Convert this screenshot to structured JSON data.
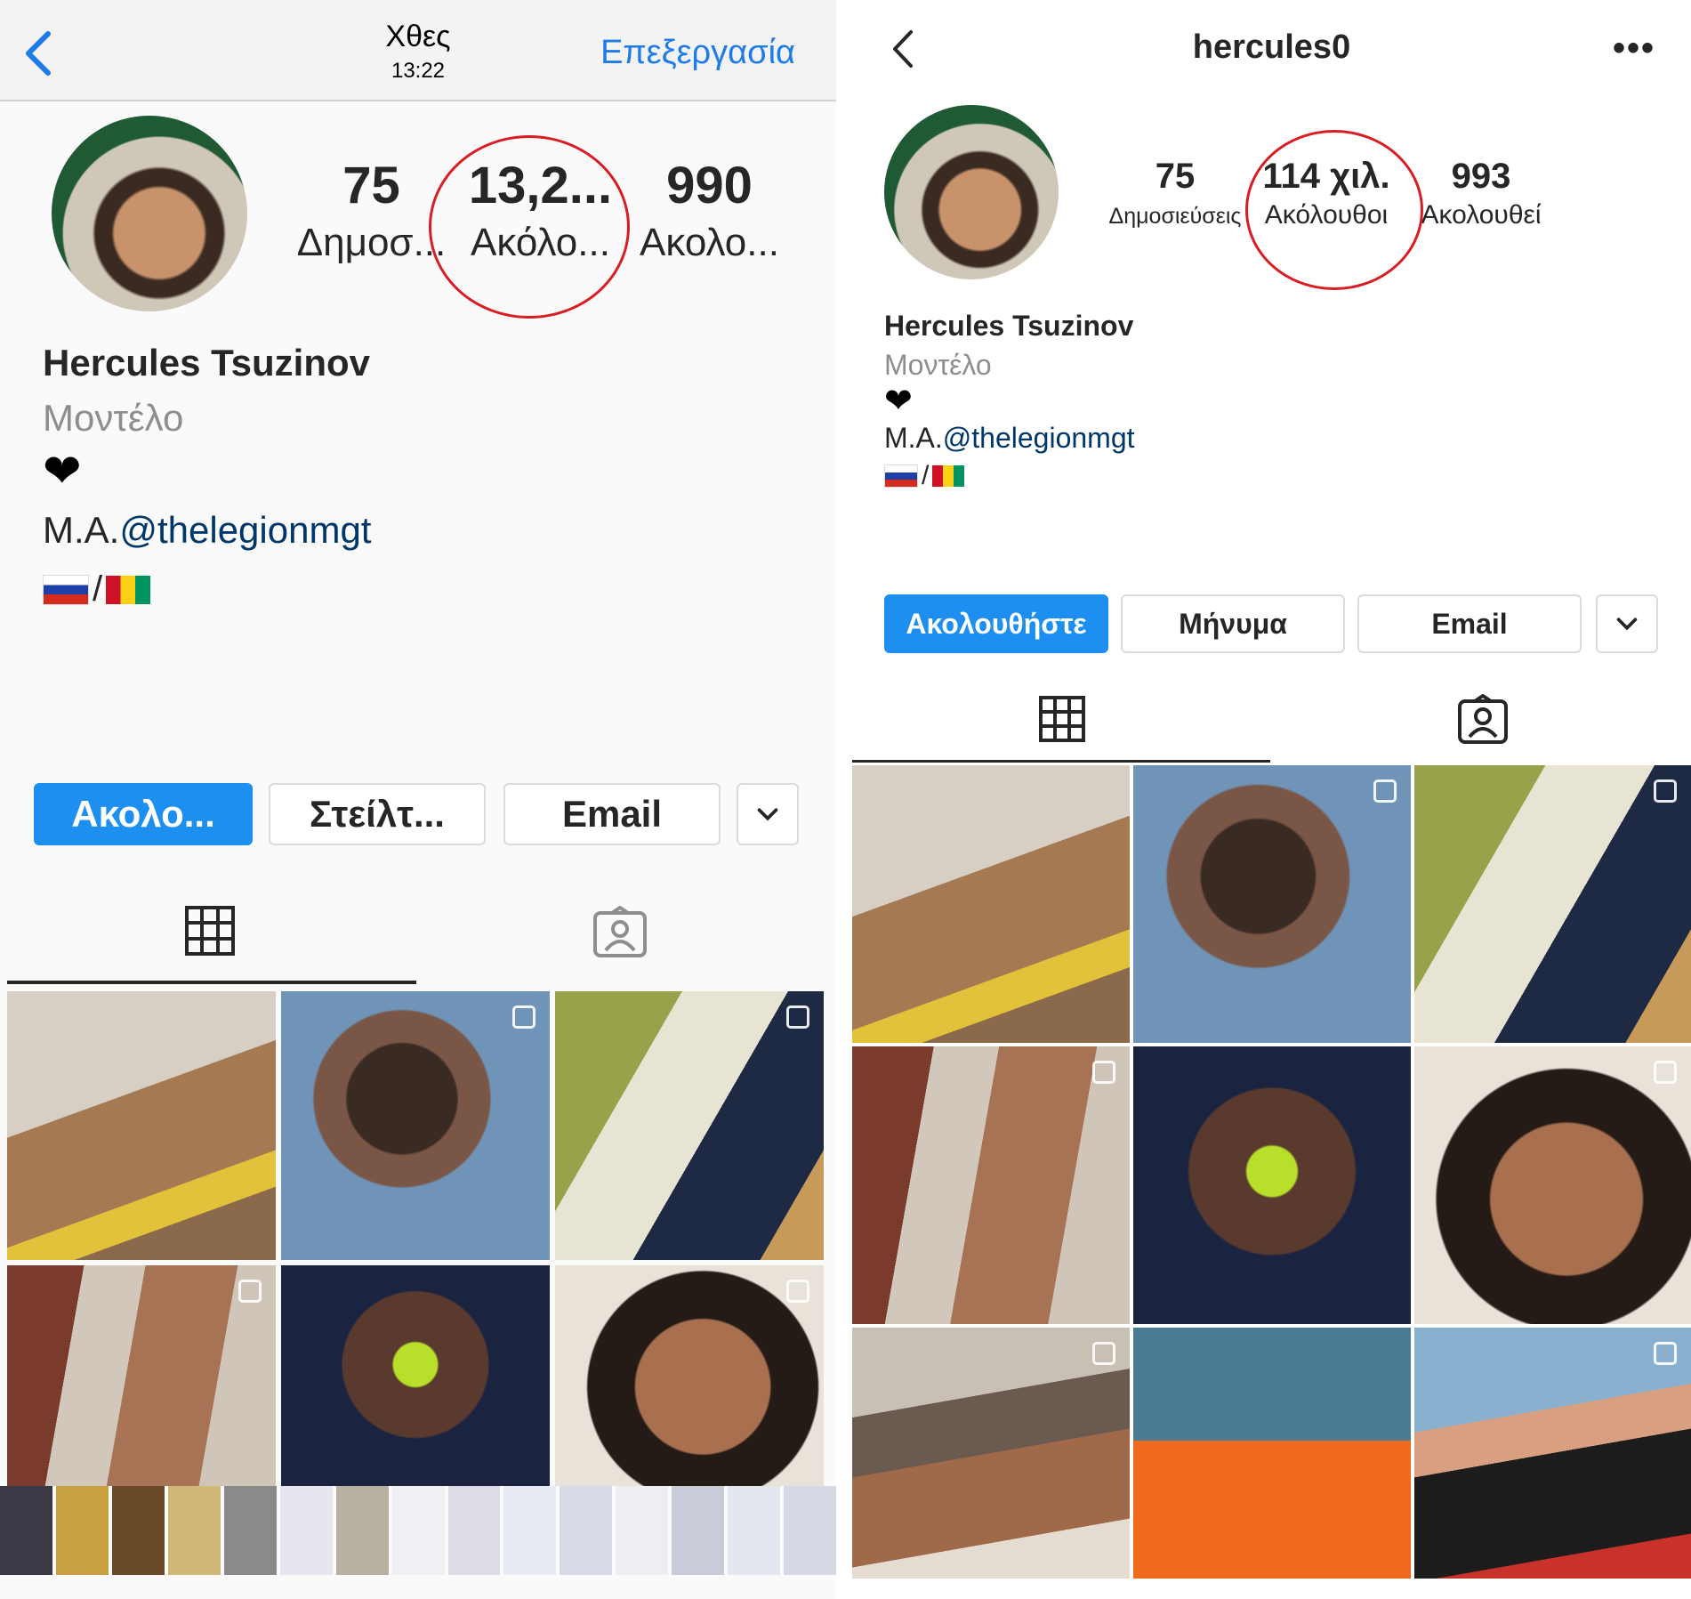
{
  "left": {
    "topbar": {
      "title": "Χθες",
      "time": "13:22",
      "edit_label": "Επεξεργασία"
    },
    "stats": [
      {
        "num": "75",
        "label": "Δημοσ..."
      },
      {
        "num": "13,2...",
        "label": "Ακόλο..."
      },
      {
        "num": "990",
        "label": "Ακολο..."
      }
    ],
    "profile": {
      "name": "Hercules Tsuzinov",
      "category": "Μοντέλο",
      "heart": "❤",
      "bio_prefix": "M.A.",
      "bio_mention": "@thelegionmgt",
      "flags_sep": "/"
    },
    "buttons": {
      "follow": "Ακολο...",
      "message": "Στείλτ...",
      "email": "Email",
      "more": "⌄"
    }
  },
  "right": {
    "header": {
      "username": "hercules0",
      "more": "•••"
    },
    "stats": [
      {
        "num": "75",
        "label": "Δημοσιεύσεις"
      },
      {
        "num": "114 χιλ.",
        "label": "Ακόλουθοι"
      },
      {
        "num": "993",
        "label": "Ακολουθεί"
      }
    ],
    "profile": {
      "name": "Hercules Tsuzinov",
      "category": "Μοντέλο",
      "heart": "❤",
      "bio_prefix": "M.A.",
      "bio_mention": "@thelegionmgt",
      "flags_sep": "/"
    },
    "buttons": {
      "follow": "Ακολουθήστε",
      "message": "Μήνυμα",
      "email": "Email",
      "more": "⌄"
    }
  },
  "colors": {
    "accent": "#1c8ff0",
    "highlight_circle": "#d81e24",
    "link": "#1f7be8"
  },
  "icons": [
    "chevron-left-icon",
    "grid-icon",
    "tagged-icon",
    "more-icon",
    "chevron-down-icon"
  ]
}
